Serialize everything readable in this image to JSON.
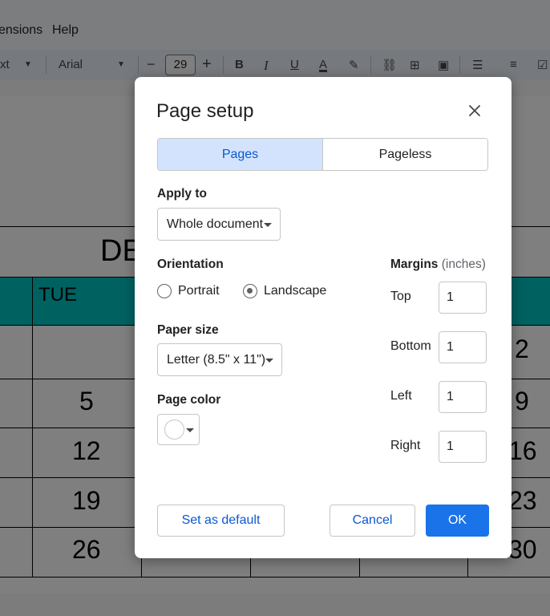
{
  "menu": {
    "extensions": "ensions",
    "help": "Help"
  },
  "toolbar": {
    "style_partial": "xt",
    "font": "Arial",
    "minus": "−",
    "font_size": "29",
    "plus": "+",
    "bold": "B",
    "italic": "I",
    "underline": "U",
    "text_color": "A"
  },
  "calendar": {
    "title_partial": "DE",
    "day_label": "TUE",
    "numbers_left": [
      "5",
      "12",
      "19",
      "26"
    ],
    "numbers_right": [
      "2",
      "9",
      "16",
      "23",
      "30"
    ],
    "header_color": "#00c2c2"
  },
  "dialog": {
    "title": "Page setup",
    "close_icon": "close-icon",
    "tabs": [
      {
        "label": "Pages",
        "active": true
      },
      {
        "label": "Pageless",
        "active": false
      }
    ],
    "apply_to": {
      "label": "Apply to",
      "value": "Whole document"
    },
    "orientation": {
      "label": "Orientation",
      "options": [
        {
          "label": "Portrait",
          "selected": false
        },
        {
          "label": "Landscape",
          "selected": true
        }
      ]
    },
    "paper_size": {
      "label": "Paper size",
      "value": "Letter (8.5\" x 11\")"
    },
    "page_color": {
      "label": "Page color",
      "value": "#ffffff"
    },
    "margins": {
      "label": "Margins",
      "unit": "(inches)",
      "fields": [
        {
          "label": "Top",
          "value": "1"
        },
        {
          "label": "Bottom",
          "value": "1"
        },
        {
          "label": "Left",
          "value": "1"
        },
        {
          "label": "Right",
          "value": "1"
        }
      ]
    },
    "buttons": {
      "set_default": "Set as default",
      "cancel": "Cancel",
      "ok": "OK"
    }
  }
}
